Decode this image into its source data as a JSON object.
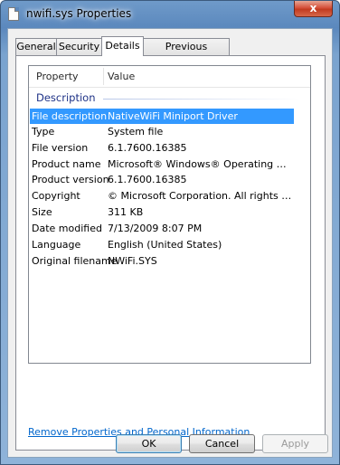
{
  "window": {
    "title": "nwifi.sys Properties",
    "close_glyph": "x"
  },
  "tabs": [
    {
      "label": "General"
    },
    {
      "label": "Security"
    },
    {
      "label": "Details"
    },
    {
      "label": "Previous Versions"
    }
  ],
  "active_tab": "Details",
  "list": {
    "columns": [
      "Property",
      "Value"
    ],
    "group": "Description",
    "rows": [
      {
        "key": "File description",
        "value": "NativeWiFi Miniport Driver"
      },
      {
        "key": "Type",
        "value": "System file"
      },
      {
        "key": "File version",
        "value": "6.1.7600.16385"
      },
      {
        "key": "Product name",
        "value": "Microsoft® Windows® Operating System"
      },
      {
        "key": "Product version",
        "value": "6.1.7600.16385"
      },
      {
        "key": "Copyright",
        "value": "© Microsoft Corporation. All rights reserv..."
      },
      {
        "key": "Size",
        "value": "311 KB"
      },
      {
        "key": "Date modified",
        "value": "7/13/2009 8:07 PM"
      },
      {
        "key": "Language",
        "value": "English (United States)"
      },
      {
        "key": "Original filename",
        "value": "NWiFi.SYS"
      }
    ],
    "selected_row": 0
  },
  "remove_link": "Remove Properties and Personal Information",
  "buttons": {
    "ok": "OK",
    "cancel": "Cancel",
    "apply": "Apply"
  },
  "colors": {
    "selection": "#3399ff",
    "link": "#0066cc",
    "group_header": "#1e3287"
  }
}
